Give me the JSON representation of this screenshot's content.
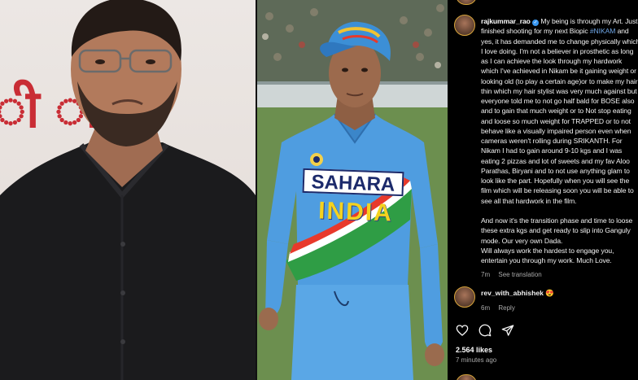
{
  "left_panel": {
    "backdrop_text": "ी  ीत"
  },
  "mid_panel": {
    "jersey_sponsor": "SAHARA",
    "jersey_country": "INDIA"
  },
  "instagram": {
    "caption": {
      "username": "rajkummar_rao",
      "text_before_hashtag": " My being is through my Art. Just finished shooting for my next Biopic ",
      "hashtag": "#NIKAM",
      "text_after_hashtag": " and yes, it has demanded me to change physically which I love doing. I'm not a believer in prosthetic as long as I can achieve the look through my hardwork which I've achieved in Nikam be it gaining weight or looking old (to play a certain age)or to make my hair thin which my hair stylist was very much against but everyone told me to not go half bald for BOSE also and to gain that much weight or to Not stop eating and loose so much weight for TRAPPED or to not behave like a visually impaired person even when cameras weren't rolling during SRIKANTH. For Nikam I had to gain around 9-10 kgs and I was eating 2 pizzas and lot of sweets and my fav Aloo Parathas, Biryani and to not use anything glam to look like the part. Hopefully when you will see the film which will be releasing soon you will be able to see all that hardwork in the film.\n\nAnd now it's the transition phase and time to loose these extra kgs and get ready to slip into Ganguly mode. Our very own Dada.\nWill always work the hardest to engage you, entertain you through my work. Much Love.",
      "age": "7m",
      "see_translation": "See translation"
    },
    "comment": {
      "username": "rev_with_abhishek",
      "emoji": "😍",
      "age": "6m",
      "reply_label": "Reply"
    },
    "actions": [
      "heart-icon",
      "comment-icon",
      "share-icon"
    ],
    "likes": "2.564 likes",
    "posted": "7 minutes ago"
  }
}
